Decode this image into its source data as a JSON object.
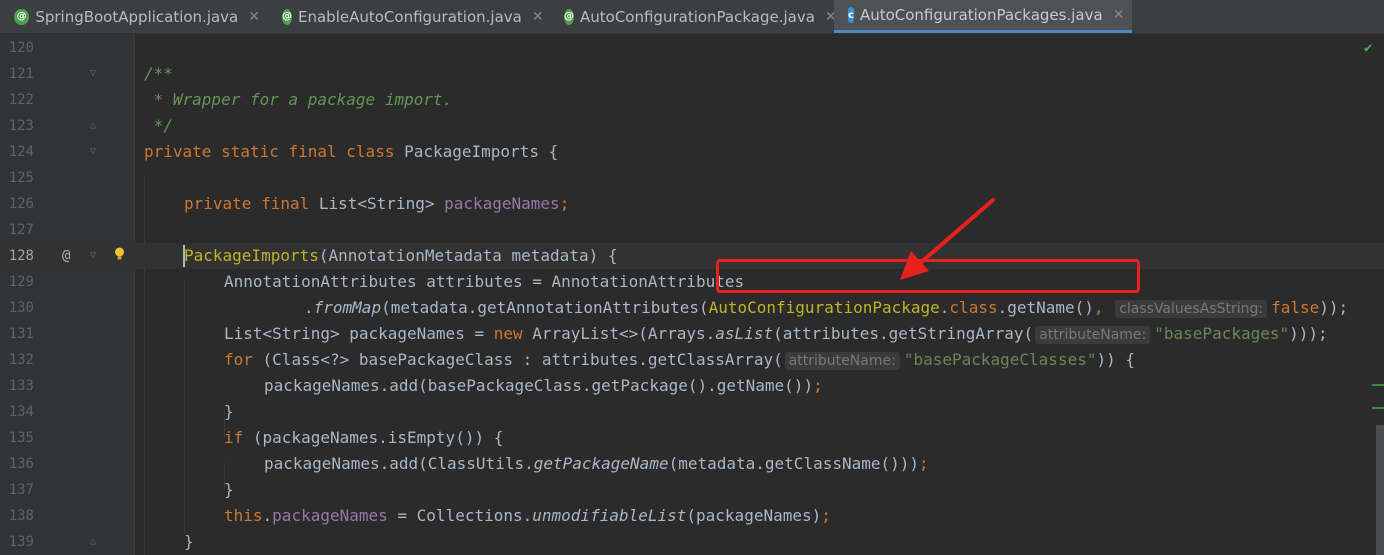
{
  "tabs": [
    {
      "label": "SpringBootApplication.java",
      "icon": "annotation-icon",
      "active": false
    },
    {
      "label": "EnableAutoConfiguration.java",
      "icon": "annotation-icon",
      "active": false
    },
    {
      "label": "AutoConfigurationPackage.java",
      "icon": "annotation-icon",
      "active": false
    },
    {
      "label": "AutoConfigurationPackages.java",
      "icon": "class-icon",
      "active": true
    }
  ],
  "gutter": {
    "line_numbers": [
      "120",
      "121",
      "122",
      "123",
      "124",
      "125",
      "126",
      "127",
      "128",
      "129",
      "130",
      "131",
      "132",
      "133",
      "134",
      "135",
      "136",
      "137",
      "138",
      "139"
    ],
    "override_marker": "@"
  },
  "code": {
    "l121": "/**",
    "l122": " * Wrapper for a package import.",
    "l123": " */",
    "l124_kw": "private static final class",
    "l124_rest": " PackageImports {",
    "l126_kw": "private final",
    "l126_type": " List<String> ",
    "l126_field": "packageNames",
    "l126_end": ";",
    "l128_name": "PackageImports",
    "l128_rest": "(AnnotationMetadata metadata) {",
    "l129": "AnnotationAttributes attributes = AnnotationAttributes",
    "l130_a": ".",
    "l130_method": "fromMap",
    "l130_b": "(metadata.getAnnotationAttributes(",
    "l130_ann": "AutoConfigurationPackage",
    "l130_c": ".",
    "l130_class": "class",
    "l130_d": ".getName()",
    "l130_comma": ",",
    "l130_hint": "classValuesAsString:",
    "l130_false": "false",
    "l130_end": "));",
    "l131_a": "List<String> packageNames = ",
    "l131_new": "new",
    "l131_b": " ArrayList<>(Arrays.",
    "l131_method": "asList",
    "l131_c": "(attributes.getStringArray(",
    "l131_hint": "attributeName:",
    "l131_str": "\"basePackages\"",
    "l131_end": ")));",
    "l132_for": "for",
    "l132_a": " (Class<?> basePackageClass : attributes.getClassArray(",
    "l132_hint": "attributeName:",
    "l132_str": "\"basePackageClasses\"",
    "l132_end": ")) {",
    "l133": "packageNames.add(basePackageClass.getPackage().getName())",
    "l133_end": ";",
    "l134": "}",
    "l135_if": "if",
    "l135_rest": " (packageNames.isEmpty()) {",
    "l136_a": "packageNames.add(ClassUtils.",
    "l136_method": "getPackageName",
    "l136_b": "(metadata.getClassName()))",
    "l136_end": ";",
    "l137": "}",
    "l138_this": "this",
    "l138_a": ".",
    "l138_field": "packageNames",
    "l138_b": " = Collections.",
    "l138_method": "unmodifiableList",
    "l138_c": "(packageNames)",
    "l138_end": ";",
    "l139": "}"
  },
  "colors": {
    "background": "#2B2B2B",
    "keyword": "#CC7832",
    "comment": "#629755",
    "string": "#6A8759",
    "field": "#9876AA",
    "annotation": "#BBB529",
    "highlight_box": "#E8211F"
  }
}
